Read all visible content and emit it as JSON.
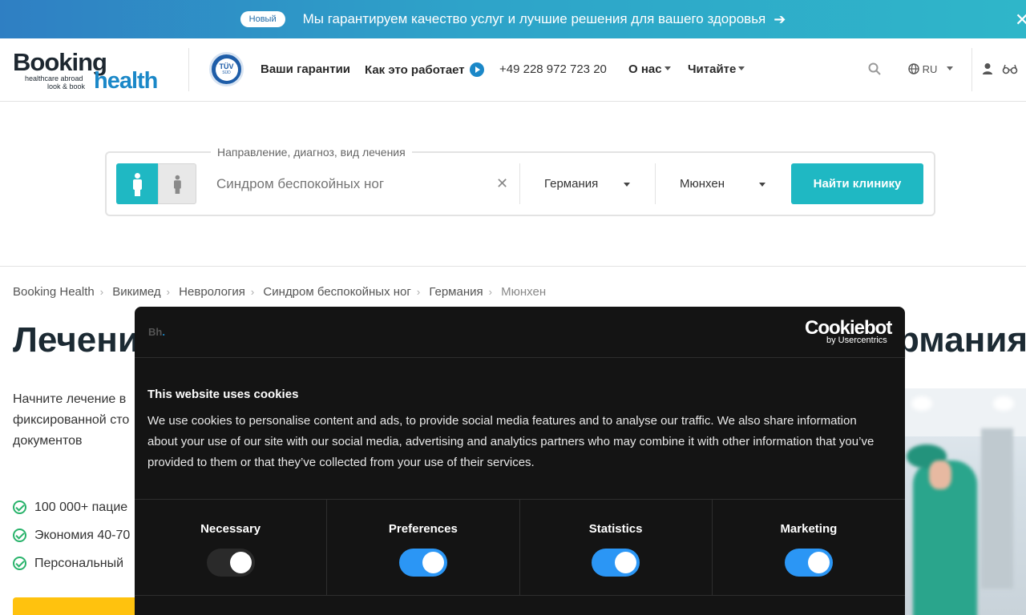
{
  "topbar": {
    "badge": "Новый",
    "message": "Мы гарантируем качество услуг и лучшие решения для вашего здоровья",
    "arrow_icon": "arrow-right-icon",
    "close_icon": "close-icon"
  },
  "header": {
    "logo": {
      "booking": "Booking",
      "health": "health",
      "tagline1": "healthcare abroad",
      "tagline2": "look & book"
    },
    "tuv": {
      "line1": "TÜV",
      "line2": "SÜD"
    },
    "nav": {
      "guarantees": "Ваши гарантии",
      "how_it_works": "Как это работает",
      "phone": "+49 228 972 723 20",
      "about": "О нас",
      "read": "Читайте"
    },
    "language": "RU"
  },
  "search": {
    "legend": "Направление, диагноз, вид лечения",
    "value": "Синдром беспокойных ног",
    "country": "Германия",
    "city": "Мюнхен",
    "button": "Найти клинику"
  },
  "breadcrumb": {
    "items": [
      "Booking Health",
      "Викимед",
      "Неврология",
      "Синдром беспокойных ног",
      "Германия",
      "Мюнхен"
    ]
  },
  "main": {
    "title_left": "Лечени",
    "title_right": "рмания",
    "intro": [
      "Начните лечение в",
      "фиксированной сто",
      "документов"
    ],
    "bullets": [
      "100 000+ пацие",
      "Экономия 40-70",
      "Персональный"
    ]
  },
  "cookie": {
    "brand_small": "Bh",
    "brand_dot": ".",
    "logo": "Cookiebot",
    "logo_sub": "by Usercentrics",
    "title": "This website uses cookies",
    "text": "We use cookies to personalise content and ads, to provide social media features and to analyse our traffic. We also share information about your use of our site with our social media, advertising and analytics partners who may combine it with other information that you’ve provided to them or that they’ve collected from your use of their services.",
    "categories": [
      {
        "label": "Necessary",
        "enabled": true,
        "locked": true
      },
      {
        "label": "Preferences",
        "enabled": true,
        "locked": false
      },
      {
        "label": "Statistics",
        "enabled": true,
        "locked": false
      },
      {
        "label": "Marketing",
        "enabled": true,
        "locked": false
      }
    ]
  },
  "colors": {
    "accent_teal": "#1fb8c3",
    "brand_blue": "#1b88c8",
    "toggle_on": "#2b96f5",
    "cta_yellow": "#ffc20e",
    "check_green": "#29b36b"
  }
}
